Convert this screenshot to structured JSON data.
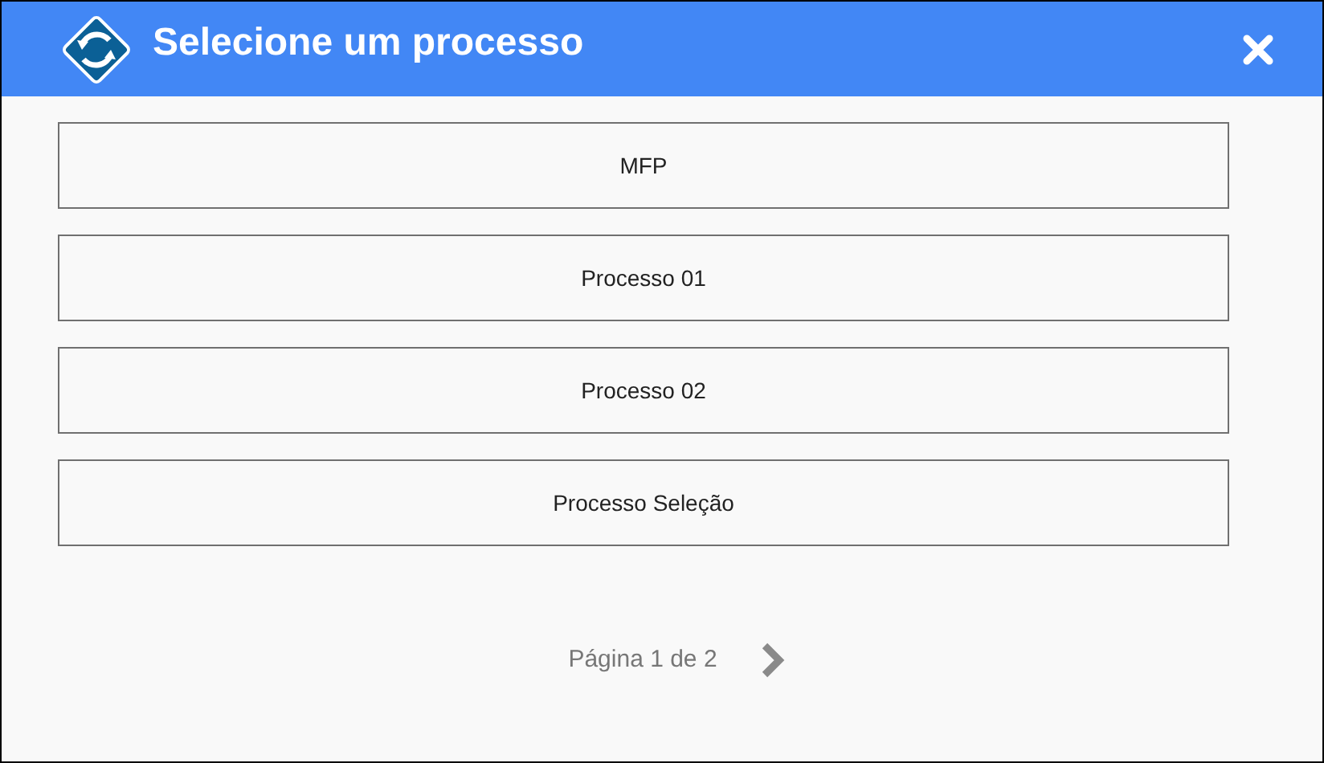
{
  "window": {
    "title": "Selecione um processo"
  },
  "processes": [
    "MFP",
    "Processo 01",
    "Processo 02",
    "Processo Seleção"
  ],
  "pagination": {
    "label": "Página 1 de 2"
  }
}
